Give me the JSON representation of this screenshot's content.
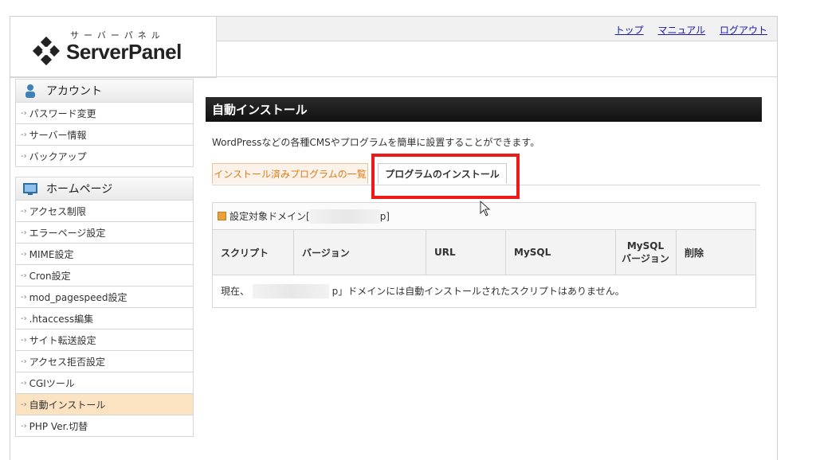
{
  "logo": {
    "kana": "サーバーパネル",
    "name": "ServerPanel"
  },
  "header": {
    "links": [
      "トップ",
      "マニュアル",
      "ログアウト"
    ]
  },
  "sidebar": {
    "sections": [
      {
        "title": "アカウント",
        "items": [
          "パスワード変更",
          "サーバー情報",
          "バックアップ"
        ]
      },
      {
        "title": "ホームページ",
        "items": [
          "アクセス制限",
          "エラーページ設定",
          "MIME設定",
          "Cron設定",
          "mod_pagespeed設定",
          ".htaccess編集",
          "サイト転送設定",
          "アクセス拒否設定",
          "CGIツール",
          "自動インストール",
          "PHP Ver.切替"
        ]
      }
    ],
    "active_item": "自動インストール"
  },
  "main": {
    "title": "自動インストール",
    "description": "WordPressなどの各種CMSやプログラムを簡単に設置することができます。",
    "tabs": [
      "インストール済みプログラムの一覧",
      "プログラムのインストール"
    ],
    "domain_label_prefix": "設定対象ドメイン[",
    "domain_label_suffix_fragment": "p]",
    "table": {
      "headers": [
        "スクリプト",
        "バージョン",
        "URL",
        "MySQL",
        "MySQL\nバージョン",
        "削除"
      ],
      "empty_prefix": "現在、",
      "empty_message": "p」ドメインには自動インストールされたスクリプトはありません。"
    }
  },
  "colors": {
    "accent": "#e07a1a",
    "highlight": "#ee1a1a",
    "link": "#1a1aa6"
  }
}
